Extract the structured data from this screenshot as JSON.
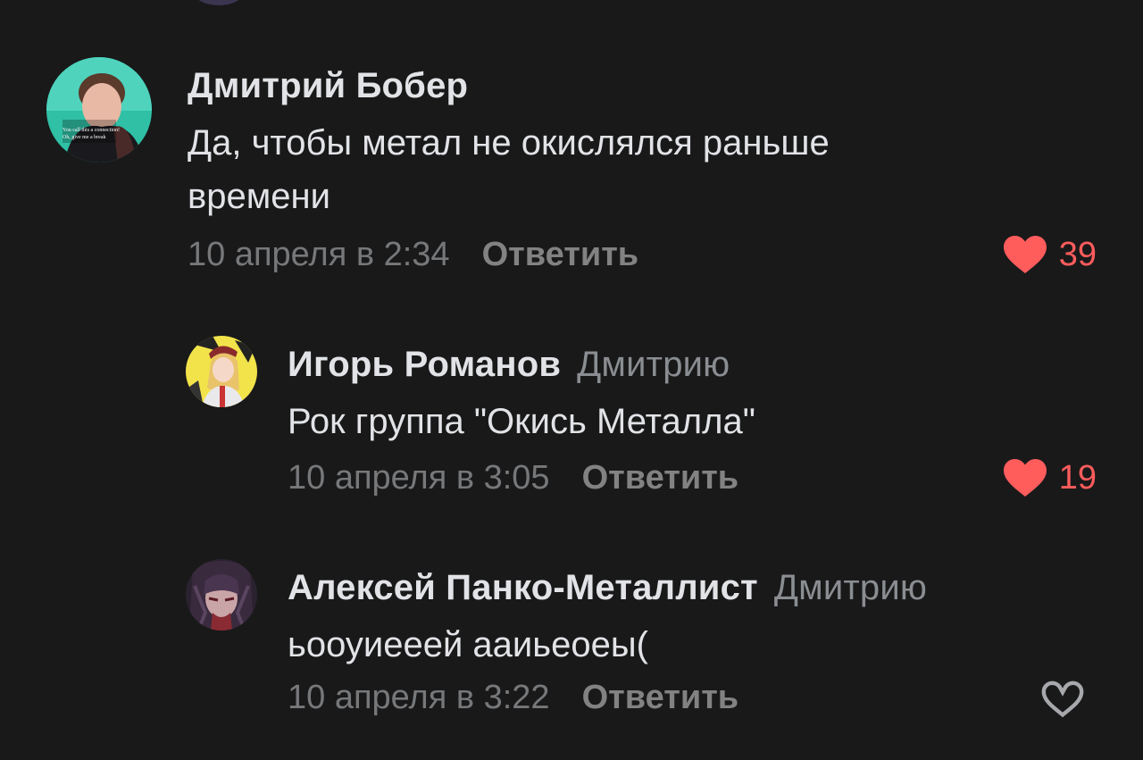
{
  "comments": [
    {
      "author": "Дмитрий Бобер",
      "reply_to": "",
      "text_lines": [
        "Да, чтобы метал не окислялся раньше",
        "времени"
      ],
      "date": "10 апреля в 2:34",
      "reply_label": "Ответить",
      "likes": "39",
      "liked": true,
      "avatar_caption": [
        "You call this a connection!",
        "Oh, give me a break"
      ]
    },
    {
      "author": "Игорь Романов",
      "reply_to": "Дмитрию",
      "text_lines": [
        "Рок группа \"Окись Металла\""
      ],
      "date": "10 апреля в 3:05",
      "reply_label": "Ответить",
      "likes": "19",
      "liked": true
    },
    {
      "author": "Алексей Панко-Металлист",
      "reply_to": "Дмитрию",
      "text_lines": [
        "ьооуиееей ааиьеоеы("
      ],
      "date": "10 апреля в 3:22",
      "reply_label": "Ответить",
      "likes": "",
      "liked": false
    }
  ],
  "colors": {
    "background": "#19191a",
    "text_primary": "#e1e3e6",
    "text_secondary": "#76787a",
    "like_active": "#ff5c5c"
  },
  "icons": [
    "heart-filled-icon",
    "heart-outline-icon"
  ]
}
